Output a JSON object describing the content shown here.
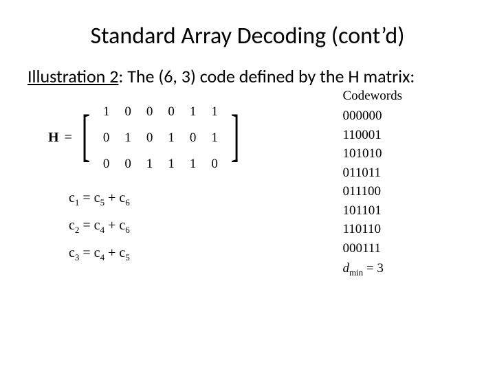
{
  "title": "Standard Array Decoding (cont’d)",
  "intro_underlined": "Illustration 2",
  "intro_rest": ": The (6, 3) code defined by the H matrix:",
  "matrix": {
    "label": "H",
    "eq": "=",
    "rows": [
      [
        "1",
        "0",
        "0",
        "0",
        "1",
        "1"
      ],
      [
        "0",
        "1",
        "0",
        "1",
        "0",
        "1"
      ],
      [
        "0",
        "0",
        "1",
        "1",
        "1",
        "0"
      ]
    ]
  },
  "equations": [
    {
      "lhs": "c",
      "lsub": "1",
      "op": " = ",
      "r1": "c",
      "r1sub": "5",
      "plus": " + ",
      "r2": "c",
      "r2sub": "6"
    },
    {
      "lhs": "c",
      "lsub": "2",
      "op": " = ",
      "r1": "c",
      "r1sub": "4",
      "plus": " + ",
      "r2": "c",
      "r2sub": "6"
    },
    {
      "lhs": "c",
      "lsub": "3",
      "op": " = ",
      "r1": "c",
      "r1sub": "4",
      "plus": " + ",
      "r2": "c",
      "r2sub": "5"
    }
  ],
  "codewords": {
    "heading": "Codewords",
    "list": [
      "000000",
      "110001",
      "101010",
      "011011",
      "011100",
      "101101",
      "110110",
      "000111"
    ],
    "dmin_sym": "d",
    "dmin_sub": "min",
    "dmin_eq": " = ",
    "dmin_val": "3"
  }
}
